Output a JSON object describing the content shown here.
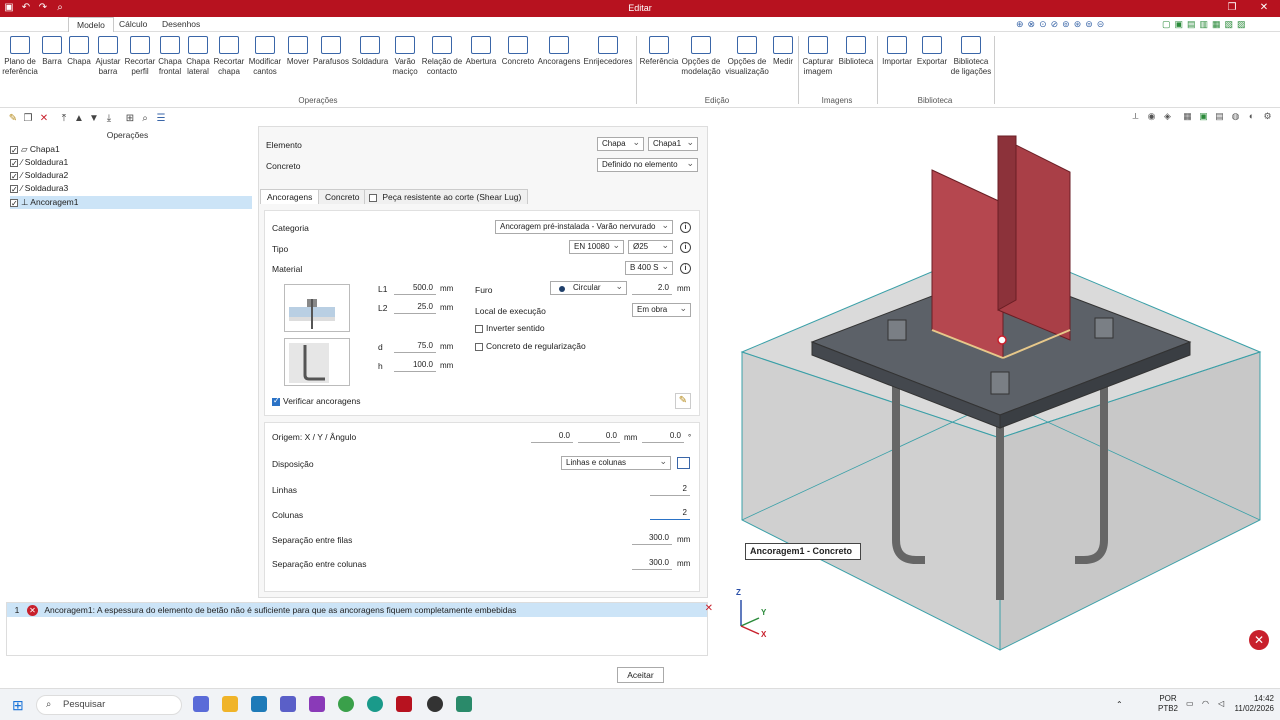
{
  "titlebar": {
    "title": "Editar",
    "restore_icon": "restore-icon",
    "close_icon": "close-icon"
  },
  "menu_tabs": [
    "Modelo",
    "Cálculo",
    "Desenhos"
  ],
  "ribbon": {
    "buttons": [
      {
        "label": "Plano de referência",
        "icon": "reference-plane-icon"
      },
      {
        "label": "Barra",
        "icon": "bar-icon"
      },
      {
        "label": "Chapa",
        "icon": "plate-icon"
      },
      {
        "label": "Ajustar barra",
        "icon": "adjust-bar-icon"
      },
      {
        "label": "Recortar perfil",
        "icon": "cut-profile-icon"
      },
      {
        "label": "Chapa frontal",
        "icon": "front-plate-icon"
      },
      {
        "label": "Chapa lateral",
        "icon": "side-plate-icon"
      },
      {
        "label": "Recortar chapa",
        "icon": "cut-plate-icon"
      },
      {
        "label": "Modificar cantos",
        "icon": "modify-corners-icon"
      },
      {
        "label": "Mover",
        "icon": "move-icon"
      },
      {
        "label": "Parafusos",
        "icon": "bolts-icon"
      },
      {
        "label": "Soldadura",
        "icon": "weld-icon"
      },
      {
        "label": "Varão maciço",
        "icon": "solid-rod-icon"
      },
      {
        "label": "Relação de contacto",
        "icon": "contact-icon"
      },
      {
        "label": "Abertura",
        "icon": "opening-icon"
      },
      {
        "label": "Concreto",
        "icon": "concrete-icon"
      },
      {
        "label": "Ancoragens",
        "icon": "anchors-icon"
      },
      {
        "label": "Enrijecedores",
        "icon": "stiffeners-icon"
      },
      {
        "label": "Referência",
        "icon": "reference-icon"
      },
      {
        "label": "Opções de modelação",
        "icon": "modeling-options-icon"
      },
      {
        "label": "Opções de visualização",
        "icon": "view-options-icon"
      },
      {
        "label": "Medir",
        "icon": "measure-icon"
      },
      {
        "label": "Capturar imagem",
        "icon": "capture-image-icon"
      },
      {
        "label": "Biblioteca",
        "icon": "library-icon"
      },
      {
        "label": "Importar",
        "icon": "import-icon"
      },
      {
        "label": "Exportar",
        "icon": "export-icon"
      },
      {
        "label": "Biblioteca de ligações",
        "icon": "connections-library-icon"
      }
    ],
    "groups": [
      "Operações",
      "Edição",
      "Imagens",
      "Biblioteca"
    ]
  },
  "tree": {
    "title": "Operações",
    "items": [
      "Chapa1",
      "Soldadura1",
      "Soldadura2",
      "Soldadura3",
      "Ancoragem1"
    ]
  },
  "panel": {
    "elemento_label": "Elemento",
    "elemento_type": "Chapa",
    "elemento_value": "Chapa1",
    "concreto_label": "Concreto",
    "concreto_value": "Definido no elemento",
    "tabs": [
      "Ancoragens",
      "Concreto",
      "Peça resistente ao corte (Shear Lug)"
    ],
    "categoria_label": "Categoria",
    "categoria_value": "Ancoragem pré-instalada - Varão nervurado",
    "tipo_label": "Tipo",
    "tipo_norma": "EN 10080",
    "tipo_diam": "Ø25",
    "material_label": "Material",
    "material_value": "B 400 S",
    "L1_label": "L1",
    "L1_value": "500.0",
    "L2_label": "L2",
    "L2_value": "25.0",
    "d_label": "d",
    "d_value": "75.0",
    "h_label": "h",
    "h_value": "100.0",
    "unit_mm": "mm",
    "furo_label": "Furo",
    "furo_type": "Circular",
    "furo_value": "2.0",
    "local_label": "Local de execução",
    "local_value": "Em obra",
    "inverter_label": "Inverter sentido",
    "regularizacao_label": "Concreto de regularização",
    "verificar_label": "Verificar ancoragens",
    "origem_label": "Origem: X / Y / Ângulo",
    "origem_x": "0.0",
    "origem_y": "0.0",
    "origem_ang": "0.0",
    "deg": "°",
    "disposicao_label": "Disposição",
    "disposicao_value": "Linhas e colunas",
    "linhas_label": "Linhas",
    "linhas_value": "2",
    "colunas_label": "Colunas",
    "colunas_value": "2",
    "sep_filas_label": "Separação entre filas",
    "sep_filas_value": "300.0",
    "sep_colunas_label": "Separação entre colunas",
    "sep_colunas_value": "300.0"
  },
  "messages": {
    "row_num": "1",
    "text": "Ancoragem1: A espessura do elemento de betão não é suficiente para que as ancoragens fiquem completamente embebidas"
  },
  "accept_label": "Aceitar",
  "view3d": {
    "tooltip": "Ancoragem1 - Concreto",
    "axis_z": "Z",
    "axis_y": "Y",
    "axis_x": "X"
  },
  "taskbar": {
    "search_placeholder": "Pesquisar",
    "lang1": "POR",
    "lang2": "PTB2",
    "time": "14:42",
    "date": "11/02/2026"
  },
  "colors": {
    "titlebar": "#b7121f",
    "plate_red": "#b5474f",
    "selection": "#cce4f7",
    "error": "#c8202c"
  }
}
